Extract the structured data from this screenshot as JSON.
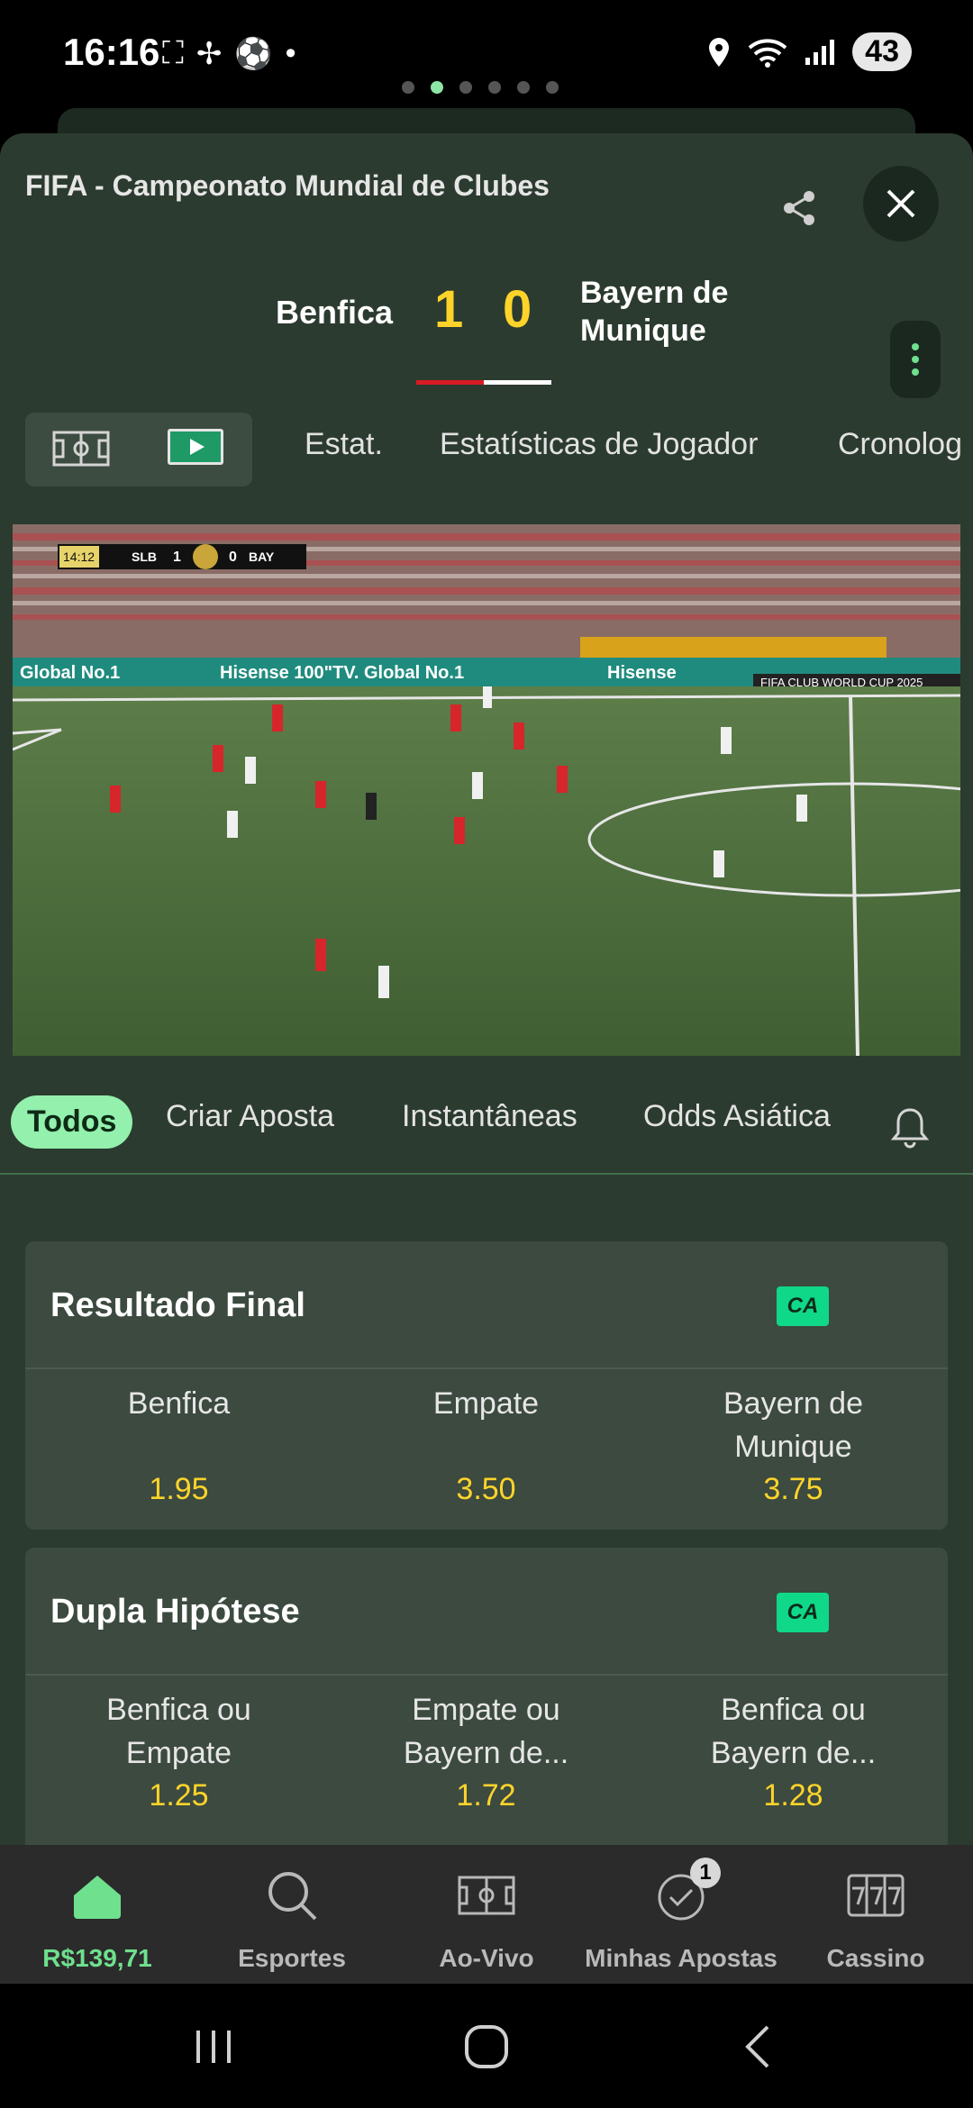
{
  "status_bar": {
    "time": "16:16",
    "battery": "43"
  },
  "header": {
    "competition": "FIFA - Campeonato Mundial de Clubes",
    "home_team": "Benfica",
    "away_team_line1": "Bayern de",
    "away_team_line2": "Munique",
    "home_score": "1",
    "away_score": "0"
  },
  "match_tabs": [
    "Estat.",
    "Estatísticas de Jogador",
    "Cronolog"
  ],
  "video": {
    "scoreboard_time": "14:12",
    "home_abbr": "SLB",
    "home_score": "1",
    "away_score": "0",
    "away_abbr": "BAY",
    "ad_text_1": "Global No.1",
    "ad_text_2": "Hisense 100\"TV. Global No.1",
    "ad_text_3": "Hisense",
    "banner": "FIFA CLUB WORLD CUP 2025"
  },
  "market_tabs": {
    "all": "Todos",
    "create_bet": "Criar Aposta",
    "instant": "Instantâneas",
    "asian": "Odds Asiática"
  },
  "markets": [
    {
      "title": "Resultado Final",
      "badge": "CA",
      "outcomes": [
        {
          "line1": "Benfica",
          "line2": "",
          "odd": "1.95"
        },
        {
          "line1": "Empate",
          "line2": "",
          "odd": "3.50"
        },
        {
          "line1": "Bayern de",
          "line2": "Munique",
          "odd": "3.75"
        }
      ]
    },
    {
      "title": "Dupla Hipótese",
      "badge": "CA",
      "outcomes": [
        {
          "line1": "Benfica ou",
          "line2": "Empate",
          "odd": "1.25"
        },
        {
          "line1": "Empate ou",
          "line2": "Bayern de...",
          "odd": "1.72"
        },
        {
          "line1": "Benfica ou",
          "line2": "Bayern de...",
          "odd": "1.28"
        }
      ]
    }
  ],
  "bottom_nav": {
    "balance": "R$139,71",
    "sports": "Esportes",
    "live": "Ao-Vivo",
    "my_bets": "Minhas Apostas",
    "my_bets_badge": "1",
    "casino": "Cassino"
  },
  "colors": {
    "accent": "#6fe08e",
    "odds": "#ffd42a",
    "panel": "#2c3b2f",
    "card": "#3c4a3f"
  }
}
